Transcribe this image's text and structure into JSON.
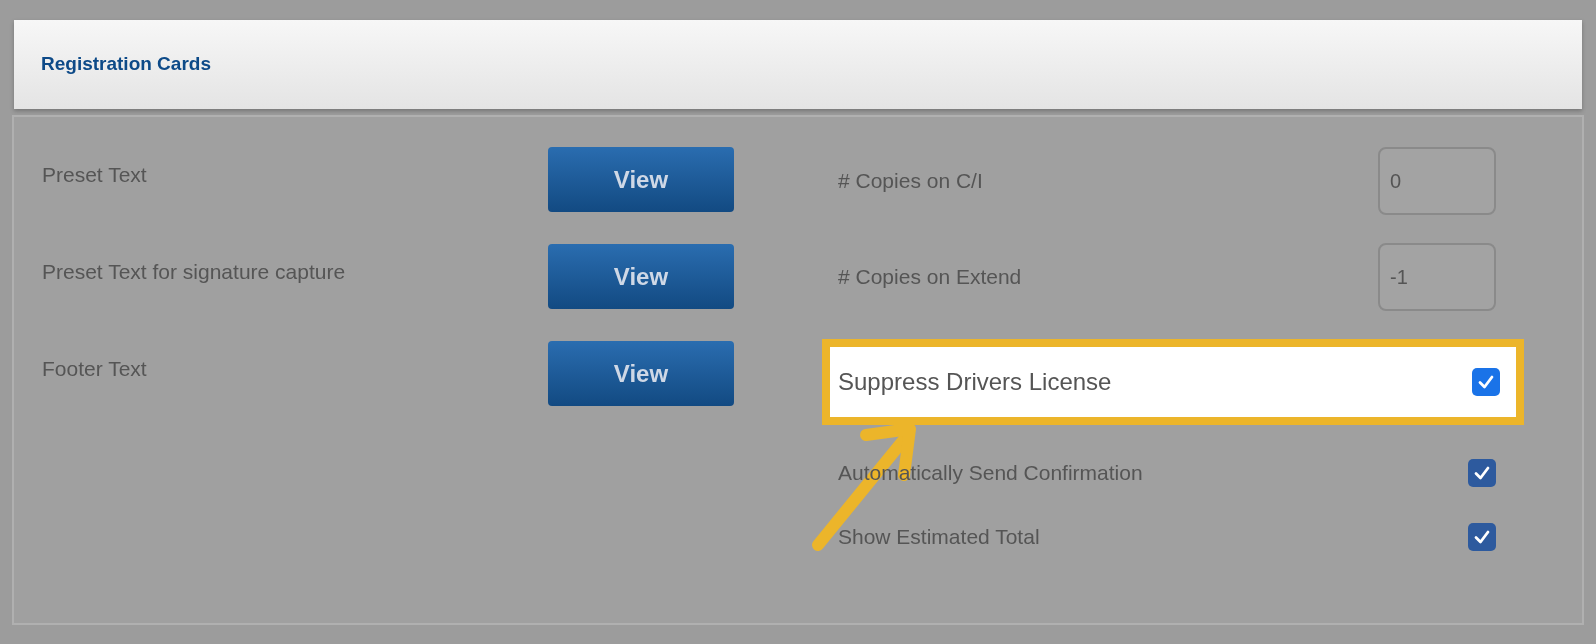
{
  "header": {
    "title": "Registration Cards"
  },
  "presets": [
    {
      "label": "Preset Text",
      "button": "View"
    },
    {
      "label": "Preset Text for signature capture",
      "button": "View"
    },
    {
      "label": "Footer Text",
      "button": "View"
    }
  ],
  "settings": [
    {
      "kind": "number",
      "label": "# Copies on C/I",
      "value": "0",
      "highlighted": false
    },
    {
      "kind": "number",
      "label": "# Copies on Extend",
      "value": "-1",
      "highlighted": false
    },
    {
      "kind": "checkbox",
      "label": "Suppress Drivers License",
      "checked": true,
      "highlighted": true
    },
    {
      "kind": "checkbox",
      "label": "Automatically Send Confirmation",
      "checked": true,
      "highlighted": false
    },
    {
      "kind": "checkbox",
      "label": "Show Estimated Total",
      "checked": true,
      "highlighted": false
    }
  ]
}
